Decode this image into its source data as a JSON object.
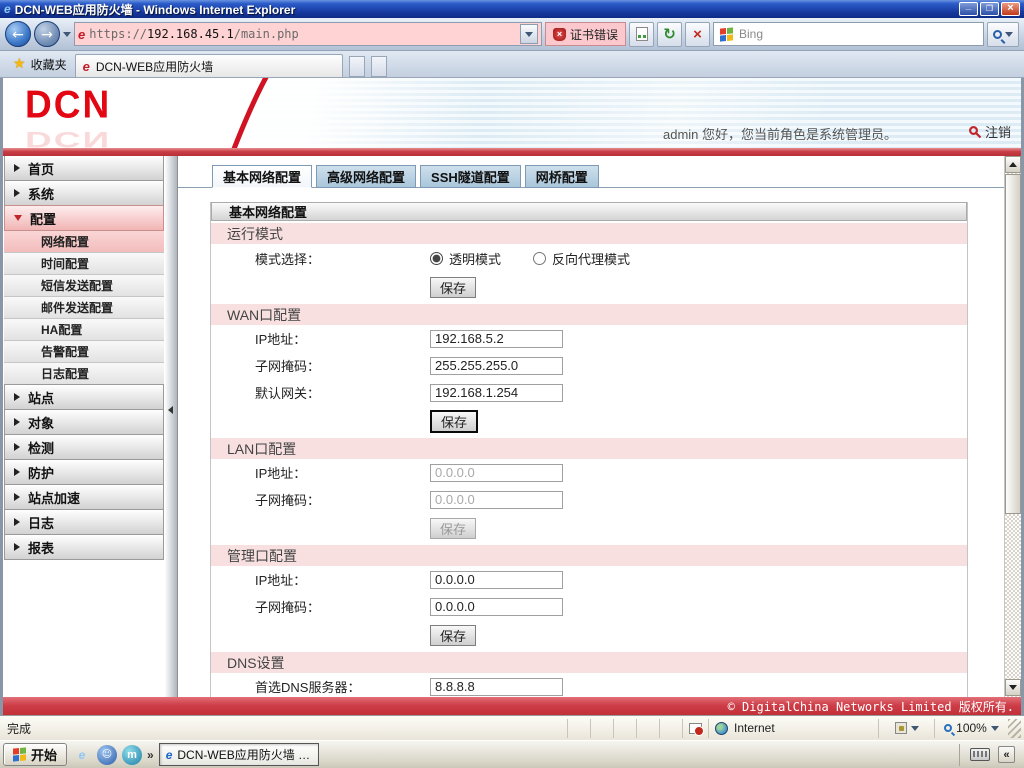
{
  "titlebar": {
    "title": "DCN-WEB应用防火墙 - Windows Internet Explorer"
  },
  "navbar": {
    "url_protocol": "https://",
    "url_host": "192.168.45.1",
    "url_path": "/main.php",
    "cert_error_label": "证书错误",
    "search_placeholder": "Bing"
  },
  "favbar": {
    "favorites_label": "收藏夹",
    "tab_title": "DCN-WEB应用防火墙"
  },
  "banner": {
    "logo_text": "DCN",
    "welcome_text": "admin 您好，您当前角色是系统管理员。",
    "logout_label": "注销"
  },
  "sidebar": {
    "items": [
      {
        "label": "首页"
      },
      {
        "label": "系统"
      },
      {
        "label": "配置"
      },
      {
        "label": "站点"
      },
      {
        "label": "对象"
      },
      {
        "label": "检测"
      },
      {
        "label": "防护"
      },
      {
        "label": "站点加速"
      },
      {
        "label": "日志"
      },
      {
        "label": "报表"
      }
    ],
    "config_sub": [
      {
        "label": "网络配置"
      },
      {
        "label": "时间配置"
      },
      {
        "label": "短信发送配置"
      },
      {
        "label": "邮件发送配置"
      },
      {
        "label": "HA配置"
      },
      {
        "label": "告警配置"
      },
      {
        "label": "日志配置"
      }
    ]
  },
  "content": {
    "tabs": [
      {
        "label": "基本网络配置"
      },
      {
        "label": "高级网络配置"
      },
      {
        "label": "SSH隧道配置"
      },
      {
        "label": "网桥配置"
      }
    ],
    "panel_title": "基本网络配置",
    "run_mode": {
      "title": "运行模式",
      "mode_label": "模式选择：",
      "opt_transparent": "透明模式",
      "opt_reverse_proxy": "反向代理模式",
      "save_label": "保存"
    },
    "wan": {
      "title": "WAN口配置",
      "ip_label": "IP地址：",
      "ip_value": "192.168.5.2",
      "mask_label": "子网掩码：",
      "mask_value": "255.255.255.0",
      "gateway_label": "默认网关：",
      "gateway_value": "192.168.1.254",
      "save_label": "保存"
    },
    "lan": {
      "title": "LAN口配置",
      "ip_label": "IP地址：",
      "ip_value": "0.0.0.0",
      "mask_label": "子网掩码：",
      "mask_value": "0.0.0.0",
      "save_label": "保存"
    },
    "mgmt": {
      "title": "管理口配置",
      "ip_label": "IP地址：",
      "ip_value": "0.0.0.0",
      "mask_label": "子网掩码：",
      "mask_value": "0.0.0.0",
      "save_label": "保存"
    },
    "dns": {
      "title": "DNS设置",
      "primary_label": "首选DNS服务器：",
      "primary_value": "8.8.8.8"
    }
  },
  "pagefooter": {
    "copyright": "© DigitalChina Networks Limited 版权所有."
  },
  "statusbar": {
    "status": "完成",
    "zone": "Internet",
    "zoom_level": "100%"
  },
  "taskbar": {
    "start_label": "开始",
    "task_label": "DCN-WEB应用防火墙 -..."
  },
  "colors": {
    "brand_red": "#E30613",
    "bar_red": "#CE3E48",
    "section_pink": "#F8E0E0",
    "address_bar_pink": "#FFD3D3",
    "tab_blue": "#B9D0E2"
  },
  "icons": {
    "titlebar": "ie-icon",
    "address": "site-favicon",
    "cert": "shield-error-icon",
    "toolbar": [
      "compatibility-view-icon",
      "refresh-icon",
      "stop-icon",
      "search-icon"
    ],
    "statusbar": [
      "popup-blocked-icon",
      "globe-icon",
      "protected-mode-icon",
      "zoom-icon"
    ],
    "taskbar": [
      "windows-flag-icon",
      "ie-icon",
      "messenger-icon",
      "browser-icon",
      "keyboard-icon"
    ]
  }
}
